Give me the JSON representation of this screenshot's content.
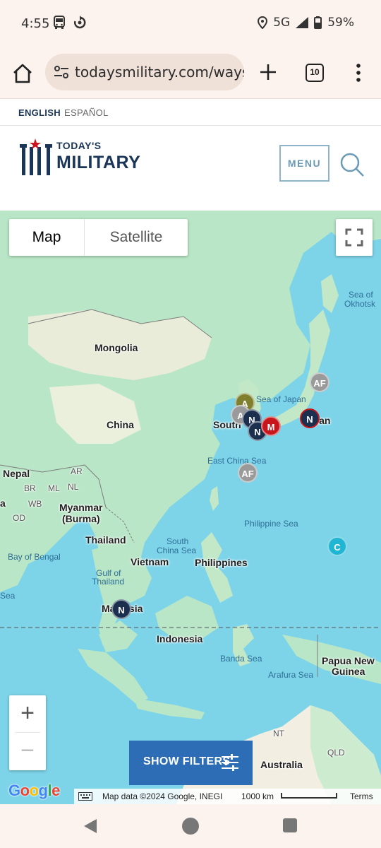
{
  "status_bar": {
    "time": "4:55",
    "network": "5G",
    "battery": "59%"
  },
  "browser": {
    "url": "todaysmilitary.com/ways",
    "tab_count": "10"
  },
  "languages": {
    "english": "ENGLISH",
    "spanish": "ESPAÑOL"
  },
  "header": {
    "logo_line1": "TODAY'S",
    "logo_line2": "MILITARY",
    "menu_label": "MENU"
  },
  "map": {
    "map_type_options": [
      "Map",
      "Satellite"
    ],
    "selected_map_type": "Map",
    "zoom_in": "+",
    "zoom_out": "−",
    "show_filters_label": "SHOW FILTERS",
    "google_logo": "Google",
    "attribution": "Map data ©2024 Google, INEGI",
    "scale_label": "1000 km",
    "terms": "Terms",
    "labels": {
      "mongolia": "Mongolia",
      "china": "China",
      "south_korea": "South",
      "japan": "Japan",
      "sea_of_japan": "Sea of Japan",
      "sea_of_okhotsk_1": "Sea of",
      "sea_of_okhotsk_2": "Okhotsk",
      "east_china_sea": "East China Sea",
      "philippine_sea": "Philippine Sea",
      "nepal": "Nepal",
      "ar": "AR",
      "br": "BR",
      "ml": "ML",
      "nl": "NL",
      "wb": "WB",
      "od": "OD",
      "myanmar_1": "Myanmar",
      "myanmar_2": "(Burma)",
      "thailand": "Thailand",
      "bay_of_bengal": "Bay of Bengal",
      "south_china_sea_1": "South",
      "south_china_sea_2": "China Sea",
      "vietnam": "Vietnam",
      "philippines": "Philippines",
      "gulf_of_thailand_1": "Gulf of",
      "gulf_of_thailand_2": "Thailand",
      "malaysia": "Malaysia",
      "indonesia": "Indonesia",
      "banda_sea": "Banda Sea",
      "arafura_sea": "Arafura Sea",
      "papua_1": "Papua New",
      "papua_2": "Guinea",
      "nt": "NT",
      "qld": "QLD",
      "australia": "Australia",
      "sea_left": "Sea",
      "a_left": "a"
    },
    "pins": [
      {
        "label": "AF",
        "color": "#9a9a9a"
      },
      {
        "label": "N",
        "color": "#1b2f4e"
      },
      {
        "label": "N",
        "color": "#1b2f4e"
      },
      {
        "label": "M",
        "color": "#c8161d"
      },
      {
        "label": "N",
        "color": "#1b2f4e"
      },
      {
        "label": "AF",
        "color": "#9a9a9a"
      },
      {
        "label": "A",
        "color": "#7f7f2e"
      },
      {
        "label": "A",
        "color": "#9a9a9a"
      },
      {
        "label": "C",
        "color": "#20b5d3"
      },
      {
        "label": "N",
        "color": "#1b2f4e"
      }
    ]
  }
}
